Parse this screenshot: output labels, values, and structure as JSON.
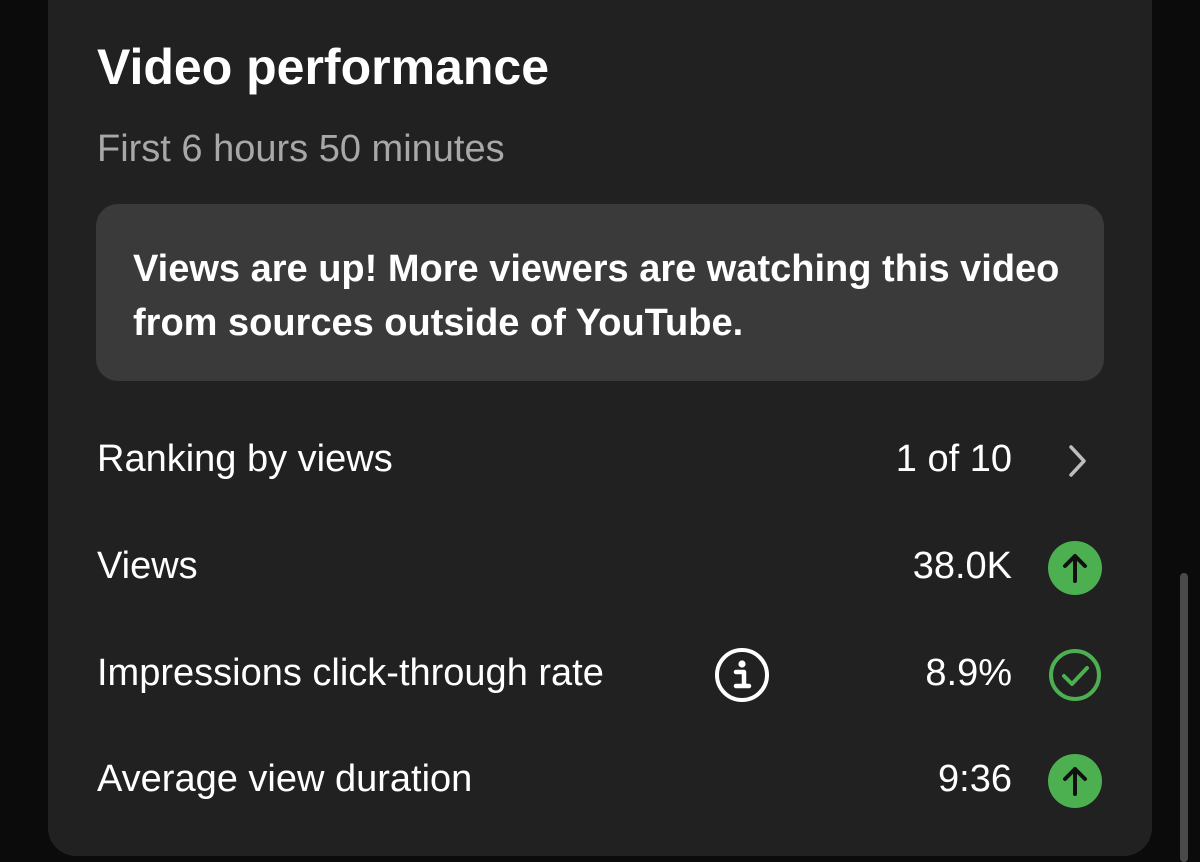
{
  "header": {
    "title": "Video performance",
    "subtitle": "First 6 hours 50 minutes"
  },
  "banner": {
    "text": "Views are up! More viewers are watching this video from sources outside of YouTube."
  },
  "metrics": [
    {
      "label": "Ranking by views",
      "value": "1 of 10",
      "indicator": "chevron-right-icon"
    },
    {
      "label": "Views",
      "value": "38.0K",
      "indicator": "arrow-up-circle-icon"
    },
    {
      "label": "Impressions click-through rate",
      "value": "8.9%",
      "indicator": "check-circle-icon",
      "has_info": true
    },
    {
      "label": "Average view duration",
      "value": "9:36",
      "indicator": "arrow-up-circle-icon"
    }
  ],
  "colors": {
    "background": "#0b0b0b",
    "card": "#212121",
    "banner": "#3a3a3a",
    "text_primary": "#ffffff",
    "text_secondary": "#a8a8a8",
    "positive": "#4caf50"
  }
}
